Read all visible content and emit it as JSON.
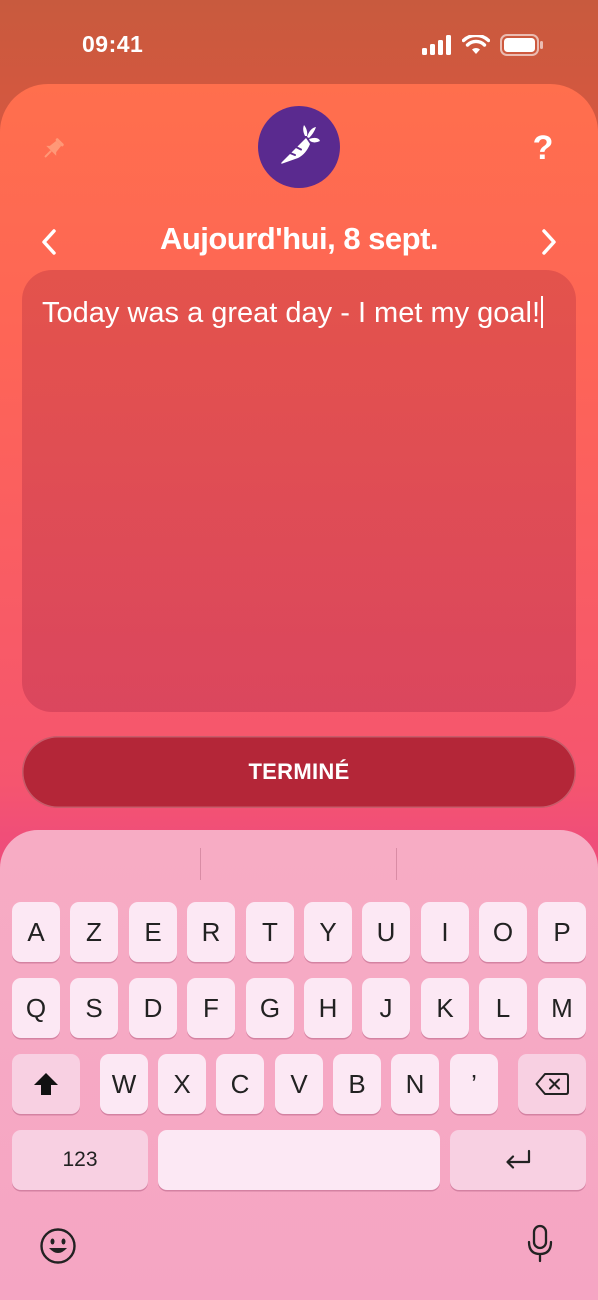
{
  "status_bar": {
    "time": "09:41"
  },
  "header": {
    "date_title": "Aujourd'hui, 8 sept.",
    "help_label": "?"
  },
  "note": {
    "text": "Today was a great day - I met my goal!"
  },
  "done_button": {
    "label": "TERMINÉ"
  },
  "keyboard": {
    "row1": [
      "A",
      "Z",
      "E",
      "R",
      "T",
      "Y",
      "U",
      "I",
      "O",
      "P"
    ],
    "row2": [
      "Q",
      "S",
      "D",
      "F",
      "G",
      "H",
      "J",
      "K",
      "L",
      "M"
    ],
    "row3": [
      "W",
      "X",
      "C",
      "V",
      "B",
      "N",
      "’"
    ],
    "numbers_label": "123"
  },
  "colors": {
    "logo_bg": "#5a2a8f",
    "done_button_bg": "#b42638",
    "key_bg": "#fce8f4"
  },
  "icons": {
    "pin": "pin-icon",
    "logo": "carrot-icon",
    "prev": "chevron-left-icon",
    "next": "chevron-right-icon",
    "shift": "shift-icon",
    "backspace": "backspace-icon",
    "return": "return-icon",
    "emoji": "emoji-icon",
    "mic": "microphone-icon"
  }
}
